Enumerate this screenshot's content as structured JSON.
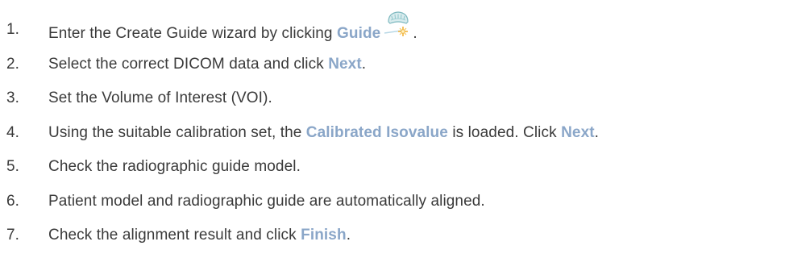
{
  "steps": [
    {
      "number": "1.",
      "parts": [
        {
          "text": "Enter the Create Guide wizard by clicking "
        },
        {
          "text": "Guide",
          "ui": true
        },
        {
          "icon": "guide-icon"
        },
        {
          "text": "."
        }
      ]
    },
    {
      "number": "2.",
      "parts": [
        {
          "text": "Select the correct DICOM data and click "
        },
        {
          "text": "Next",
          "ui": true
        },
        {
          "text": "."
        }
      ]
    },
    {
      "number": "3.",
      "parts": [
        {
          "text": "Set the Volume of Interest (VOI)."
        }
      ]
    },
    {
      "number": "4.",
      "parts": [
        {
          "text": "Using the suitable calibration set, the "
        },
        {
          "text": "Calibrated Isovalue",
          "ui": true
        },
        {
          "text": " is loaded. Click "
        },
        {
          "text": "Next",
          "ui": true
        },
        {
          "text": "."
        }
      ]
    },
    {
      "number": "5.",
      "parts": [
        {
          "text": "Check the radiographic guide model."
        }
      ]
    },
    {
      "number": "6.",
      "parts": [
        {
          "text": "Patient model and radiographic guide are automatically aligned."
        }
      ]
    },
    {
      "number": "7.",
      "parts": [
        {
          "text": "Check the alignment result and click "
        },
        {
          "text": "Finish",
          "ui": true
        },
        {
          "text": "."
        }
      ]
    }
  ],
  "colors": {
    "body_text": "#3a3a3a",
    "ui_term": "#8aa6c8"
  }
}
